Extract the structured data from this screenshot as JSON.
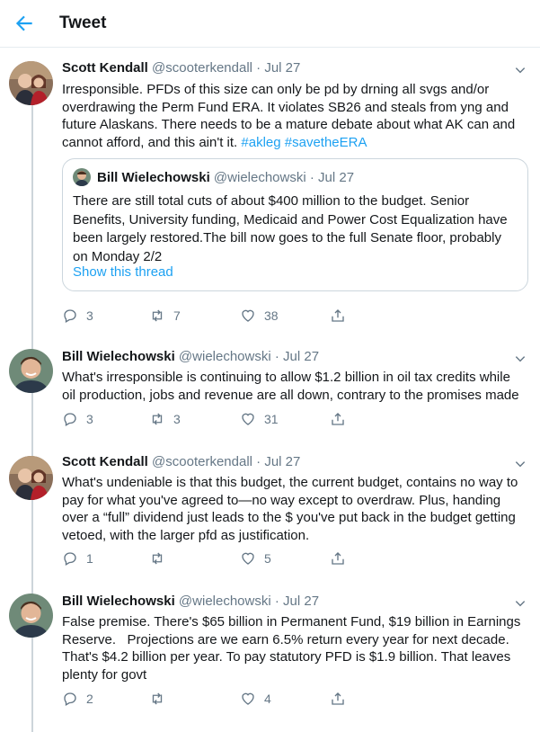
{
  "header": {
    "title": "Tweet"
  },
  "tweets": [
    {
      "name": "Scott Kendall",
      "handle": "@scooterkendall",
      "sep": "·",
      "date": "Jul 27",
      "lines": [
        "Irresponsible. PFDs of this size can only be pd by drning all svgs and/or",
        "overdrawing the Perm Fund ERA. It violates SB26 and steals from yng and",
        "future Alaskans. There needs to be a mature debate about what AK can and",
        "cannot afford, and this ain't it."
      ],
      "hashtags": [
        "#akleg",
        "#savetheERA"
      ],
      "quote": {
        "name": "Bill Wielechowski",
        "handle": "@wielechowski",
        "sep": "·",
        "date": "Jul 27",
        "lines": [
          "There are still total cuts of about $400 million to the budget. Senior",
          "Benefits, University funding, Medicaid and Power Cost Equalization have",
          "been largely restored.The bill now goes to the full Senate floor, probably",
          "on Monday 2/2"
        ],
        "link": "Show this thread"
      },
      "replies": "3",
      "retweets": "7",
      "likes": "38"
    },
    {
      "name": "Bill Wielechowski",
      "handle": "@wielechowski",
      "sep": "·",
      "date": "Jul 27",
      "lines": [
        "What's irresponsible is continuing to allow $1.2 billion in oil tax credits while",
        "oil production, jobs and revenue are all down, contrary to the promises made"
      ],
      "replies": "3",
      "retweets": "3",
      "likes": "31"
    },
    {
      "name": "Scott Kendall",
      "handle": "@scooterkendall",
      "sep": "·",
      "date": "Jul 27",
      "lines": [
        "What's undeniable is that this budget, the current budget, contains no way to",
        "pay for what you've agreed to—no way except to overdraw. Plus, handing",
        "over a “full” dividend just leads to the $ you've put back in the budget getting",
        "vetoed, with the larger pfd as justification."
      ],
      "replies": "1",
      "retweets": "",
      "likes": "5"
    },
    {
      "name": "Bill Wielechowski",
      "handle": "@wielechowski",
      "sep": "·",
      "date": "Jul 27",
      "lines": [
        "False premise. There's $65 billion in Permanent Fund, $19 billion in Earnings",
        "Reserve.   Projections are we earn 6.5% return every year for next decade.",
        "That's $4.2 billion per year. To pay statutory PFD is $1.9 billion. That leaves",
        "plenty for govt"
      ],
      "replies": "2",
      "retweets": "",
      "likes": "4"
    }
  ],
  "icons": {
    "back": "back-arrow-icon",
    "chevron": "chevron-down-icon",
    "reply": "reply-icon",
    "retweet": "retweet-icon",
    "like": "like-icon",
    "share": "share-icon"
  },
  "colors": {
    "accent": "#1da1f2",
    "muted": "#657786",
    "border": "#e6ecf0"
  }
}
